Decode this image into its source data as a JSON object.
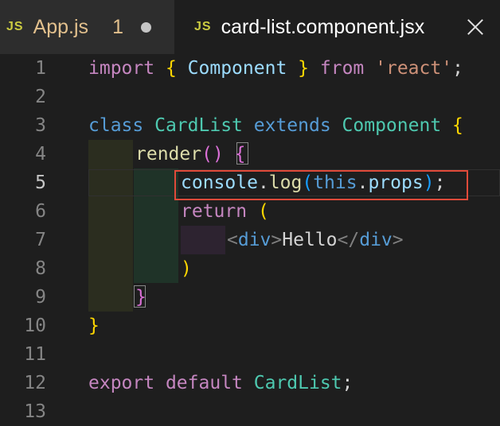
{
  "tabs": [
    {
      "badge": "JS",
      "name": "App.js",
      "count": "1",
      "state": "modified"
    },
    {
      "badge": "JS",
      "name": "card-list.component.jsx",
      "state": "active"
    }
  ],
  "line_numbers": [
    "1",
    "2",
    "3",
    "4",
    "5",
    "6",
    "7",
    "8",
    "9",
    "10",
    "11",
    "12",
    "13"
  ],
  "current_line": "5",
  "code": {
    "l1": {
      "t1": "import",
      "t2": " ",
      "t3": "{",
      "t4": " ",
      "t5": "Component",
      "t6": " ",
      "t7": "}",
      "t8": " ",
      "t9": "from",
      "t10": " ",
      "t11": "'react'",
      "t12": ";"
    },
    "l3": {
      "t1": "class",
      "t2": " ",
      "t3": "CardList",
      "t4": " ",
      "t5": "extends",
      "t6": " ",
      "t7": "Component",
      "t8": " ",
      "t9": "{"
    },
    "l4": {
      "t1": "render",
      "t2": "()",
      "t3": " ",
      "t4": "{"
    },
    "l5": {
      "t1": "console",
      "t2": ".",
      "t3": "log",
      "t4": "(",
      "t5": "this",
      "t6": ".",
      "t7": "props",
      "t8": ")",
      "t9": ";"
    },
    "l6": {
      "t1": "return",
      "t2": " ",
      "t3": "("
    },
    "l7": {
      "t1": "<",
      "t2": "div",
      "t3": ">",
      "t4": "Hello",
      "t5": "</",
      "t6": "div",
      "t7": ">"
    },
    "l8": {
      "t1": ")"
    },
    "l9": {
      "t1": "}"
    },
    "l10": {
      "t1": "}"
    },
    "l12": {
      "t1": "export",
      "t2": " ",
      "t3": "default",
      "t4": " ",
      "t5": "CardList",
      "t6": ";"
    }
  },
  "colors": {
    "background": "#1e1e1e",
    "highlight_border": "#e04a3a",
    "keyword": "#c586c0",
    "storage": "#569cd6",
    "class_name": "#4ec9b0",
    "variable": "#9cdcfe",
    "function": "#dcdcaa",
    "string": "#ce9178"
  },
  "icons": {
    "close": "close-icon",
    "modified": "dirty-dot-icon",
    "file_type": "js-file-icon"
  }
}
